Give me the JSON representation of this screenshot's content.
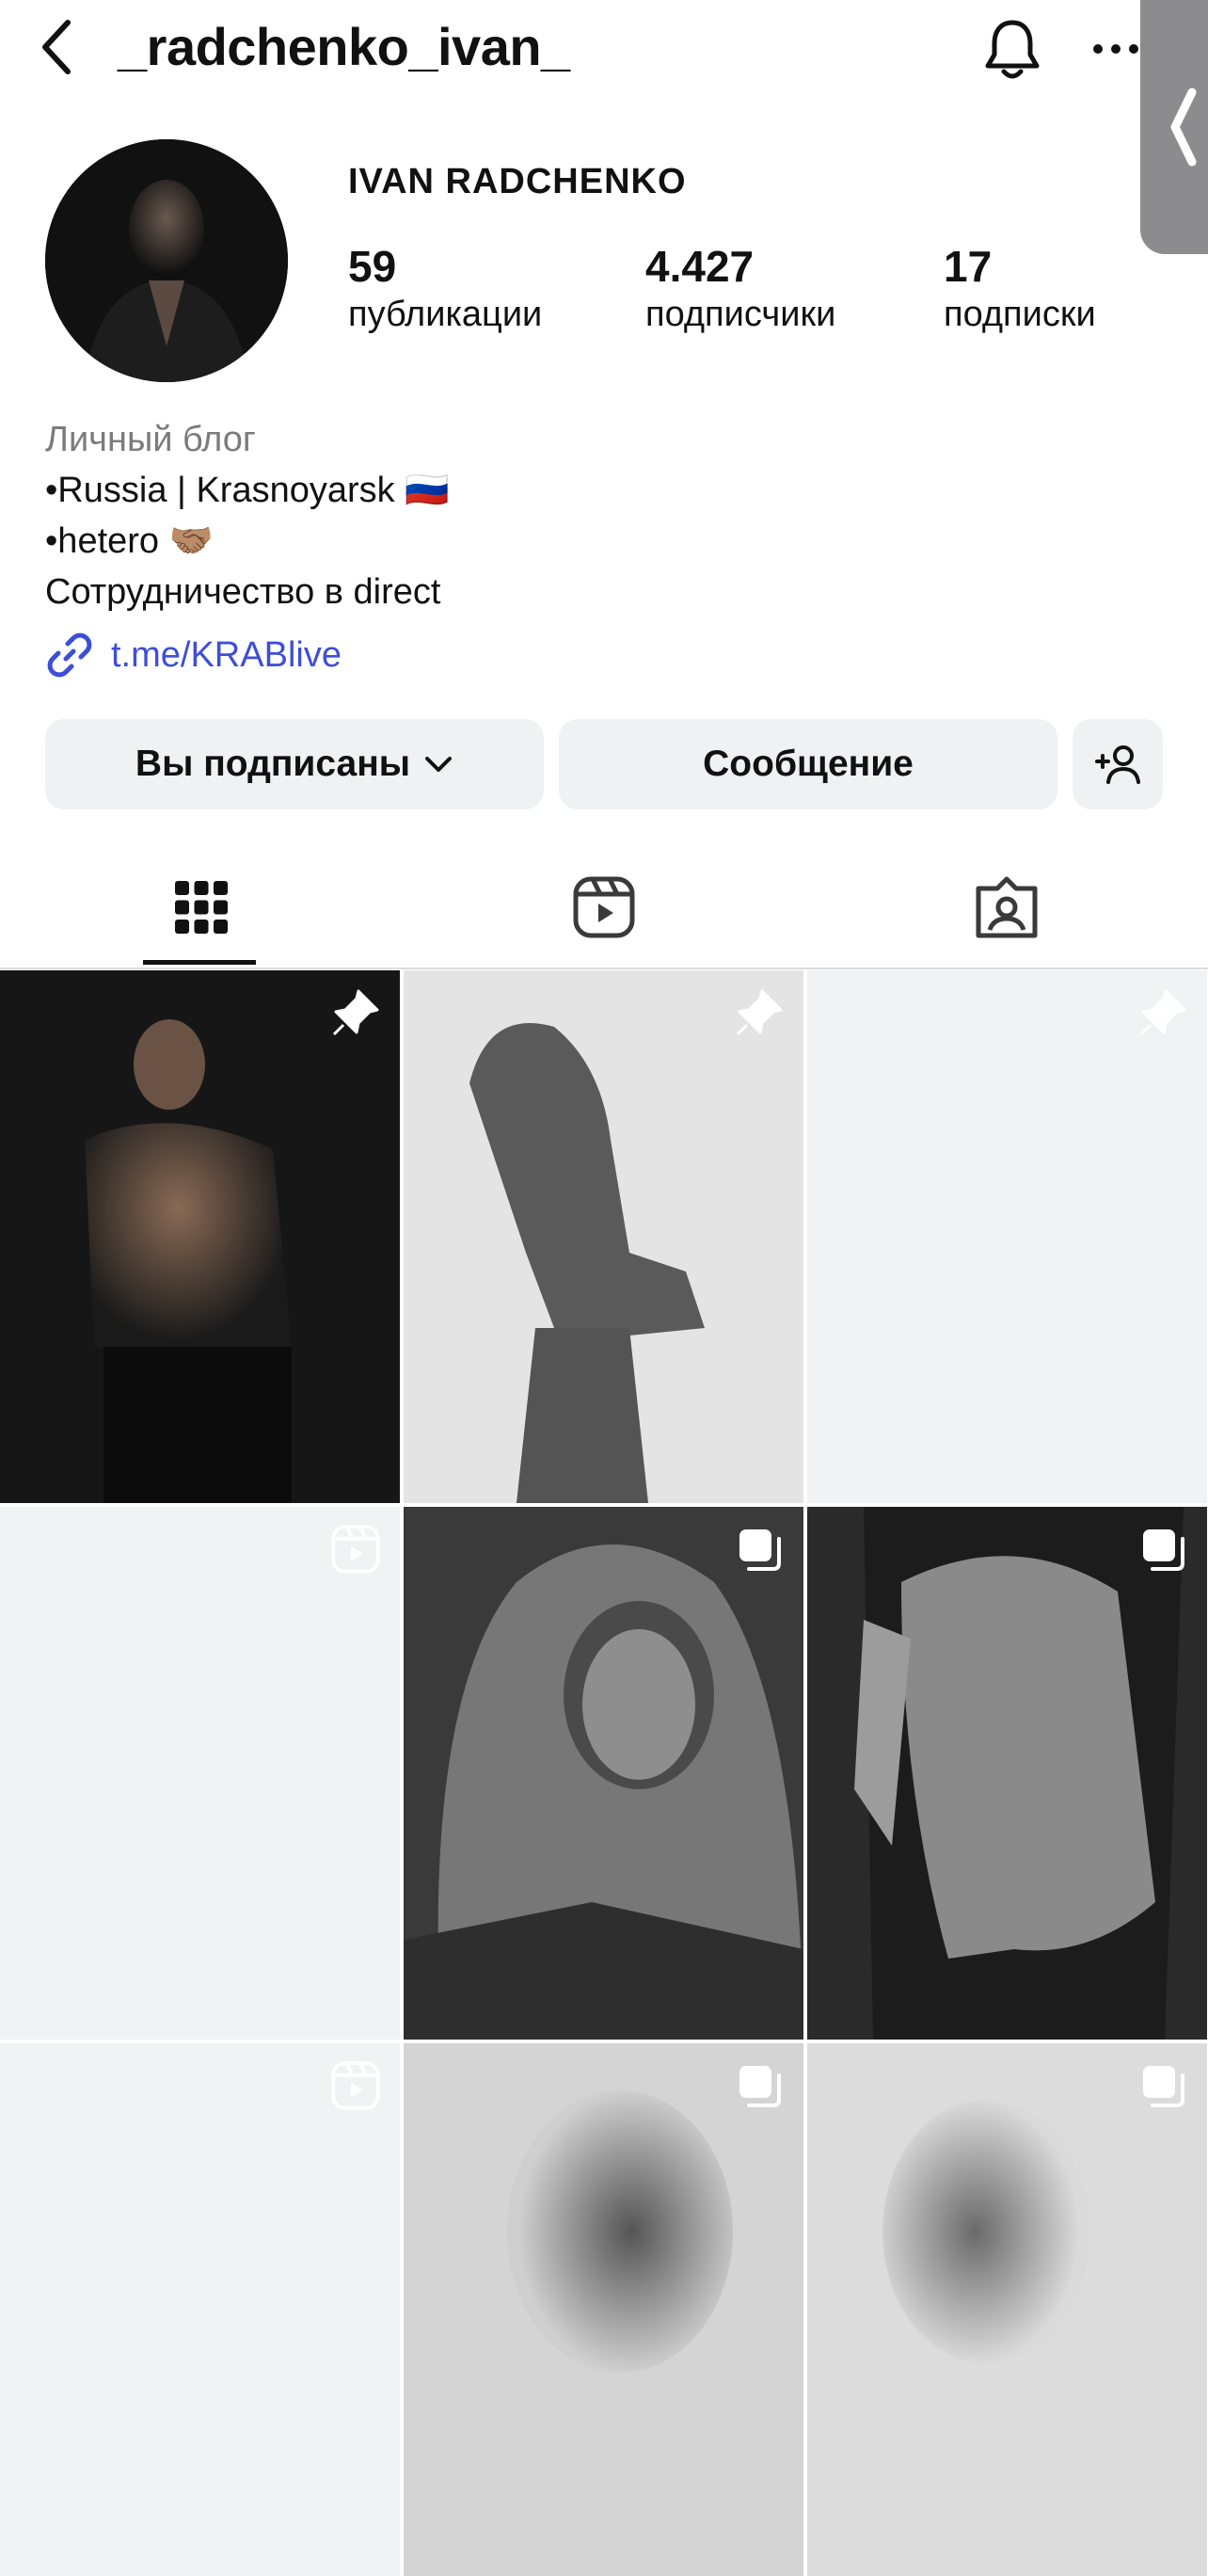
{
  "header": {
    "username": "_radchenko_ivan_",
    "back_icon": "chevron-left-icon",
    "bell_icon": "bell-icon",
    "more_icon": "more-horizontal-icon"
  },
  "profile": {
    "full_name": "IVAN RADCHENKO",
    "stats": [
      {
        "value": "59",
        "label": "публикации"
      },
      {
        "value": "4.427",
        "label": "подписчики"
      },
      {
        "value": "17",
        "label": "подписки"
      }
    ],
    "category": "Личный блог",
    "bio_lines": [
      "•Russia | Krasnoyarsk 🇷🇺",
      "•hetero 🤝🏽",
      "Сотрудничество в direct"
    ],
    "link": "t.me/KRABlive"
  },
  "actions": {
    "following_label": "Вы подписаны",
    "message_label": "Сообщение"
  },
  "tabs": [
    "grid-icon",
    "reels-icon",
    "tagged-icon"
  ],
  "posts": [
    {
      "badge": "pin-icon"
    },
    {
      "badge": "pin-icon"
    },
    {
      "badge": "pin-icon"
    },
    {
      "badge": "reels-icon"
    },
    {
      "badge": "carousel-icon"
    },
    {
      "badge": "carousel-icon"
    },
    {
      "badge": "reels-icon"
    },
    {
      "badge": "carousel-icon"
    },
    {
      "badge": "carousel-icon"
    }
  ],
  "colors": {
    "link": "#3d4fd8",
    "button_bg": "#eff1f3",
    "placeholder": "#f0f2f4"
  }
}
